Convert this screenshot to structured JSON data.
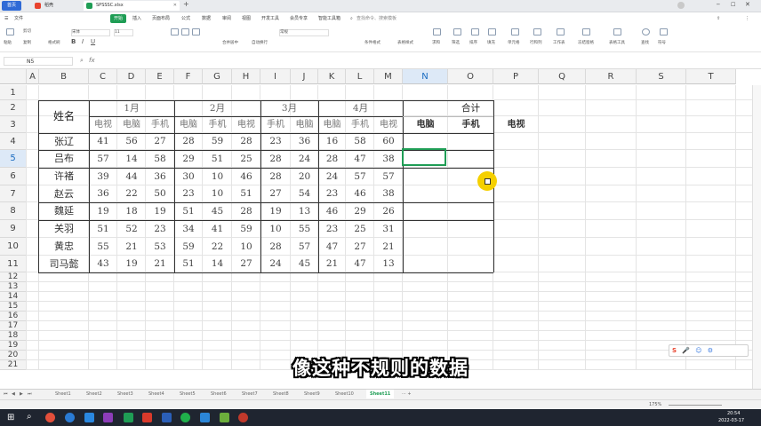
{
  "titlebar": {
    "home_button": "首页",
    "tabs": [
      {
        "label": "稻壳",
        "icon": "docer-icon",
        "color": "#e8432e"
      },
      {
        "label": "SPSSSC.xlsx",
        "icon": "excel-icon",
        "color": "#1f9d55"
      }
    ],
    "add_tab": "+"
  },
  "menubar": {
    "file": "文件",
    "items": [
      "开始",
      "插入",
      "页面布局",
      "公式",
      "数据",
      "审阅",
      "视图",
      "开发工具",
      "会员专享",
      "智能工具箱"
    ],
    "active": "开始",
    "search_placeholder": "查找命令、搜索模板"
  },
  "ribbon": {
    "groups": [
      "粘贴",
      "剪切",
      "复制",
      "格式刷",
      "宋体",
      "11",
      "合并居中",
      "自动换行",
      "常规",
      "条件格式",
      "表格样式",
      "求和",
      "筛选",
      "排序",
      "填充",
      "单元格",
      "行和列",
      "工作表",
      "冻结窗格",
      "表格工具",
      "查找",
      "符号"
    ]
  },
  "formula_bar": {
    "name_box": "N5",
    "fx": "fx",
    "value": ""
  },
  "columns": [
    "A",
    "B",
    "C",
    "D",
    "E",
    "F",
    "G",
    "H",
    "I",
    "J",
    "K",
    "L",
    "M",
    "N",
    "O",
    "P",
    "Q",
    "R",
    "S",
    "T"
  ],
  "rows": [
    "1",
    "2",
    "3",
    "4",
    "5",
    "6",
    "7",
    "8",
    "9",
    "10",
    "11",
    "12",
    "13",
    "14",
    "15",
    "16",
    "17",
    "18",
    "19",
    "20",
    "21"
  ],
  "active_col": "N",
  "active_row": "5",
  "table": {
    "name_header": "姓名",
    "months": [
      "1月",
      "2月",
      "3月",
      "4月"
    ],
    "total": "合计",
    "subheaders": [
      "电视",
      "电脑",
      "手机",
      "电脑",
      "手机",
      "电视",
      "手机",
      "电脑",
      "电脑",
      "手机",
      "电视",
      "电脑",
      "手机",
      "电视"
    ],
    "data": [
      {
        "name": "张辽",
        "values": [
          "41",
          "56",
          "27",
          "28",
          "59",
          "28",
          "23",
          "36",
          "16",
          "58",
          "60"
        ]
      },
      {
        "name": "吕布",
        "values": [
          "57",
          "14",
          "58",
          "29",
          "51",
          "25",
          "28",
          "24",
          "28",
          "47",
          "38"
        ]
      },
      {
        "name": "许褚",
        "values": [
          "39",
          "44",
          "36",
          "30",
          "10",
          "46",
          "28",
          "20",
          "24",
          "57",
          "57"
        ]
      },
      {
        "name": "赵云",
        "values": [
          "36",
          "22",
          "50",
          "23",
          "10",
          "51",
          "27",
          "54",
          "23",
          "46",
          "38"
        ]
      },
      {
        "name": "魏延",
        "values": [
          "19",
          "18",
          "19",
          "51",
          "45",
          "28",
          "19",
          "13",
          "46",
          "29",
          "26"
        ]
      },
      {
        "name": "关羽",
        "values": [
          "51",
          "52",
          "23",
          "34",
          "41",
          "59",
          "10",
          "55",
          "23",
          "25",
          "31"
        ]
      },
      {
        "name": "黄忠",
        "values": [
          "55",
          "21",
          "53",
          "59",
          "22",
          "10",
          "28",
          "57",
          "47",
          "27",
          "21"
        ]
      },
      {
        "name": "司马懿",
        "values": [
          "43",
          "19",
          "21",
          "51",
          "14",
          "27",
          "24",
          "45",
          "21",
          "47",
          "13"
        ]
      }
    ]
  },
  "sheets": [
    "Sheet1",
    "Sheet2",
    "Sheet3",
    "Sheet4",
    "Sheet5",
    "Sheet6",
    "Sheet7",
    "Sheet8",
    "Sheet9",
    "Sheet10",
    "Sheet11"
  ],
  "active_sheet": "Sheet11",
  "status": {
    "zoom": "175%"
  },
  "subtitle": "像这种不规则的数据",
  "taskbar": {
    "time": "20:54",
    "date": "2022-03-17"
  },
  "colors": {
    "accent": "#1f9d55",
    "selection": "#1f9d55",
    "header_highlight": "#dde9f7"
  }
}
